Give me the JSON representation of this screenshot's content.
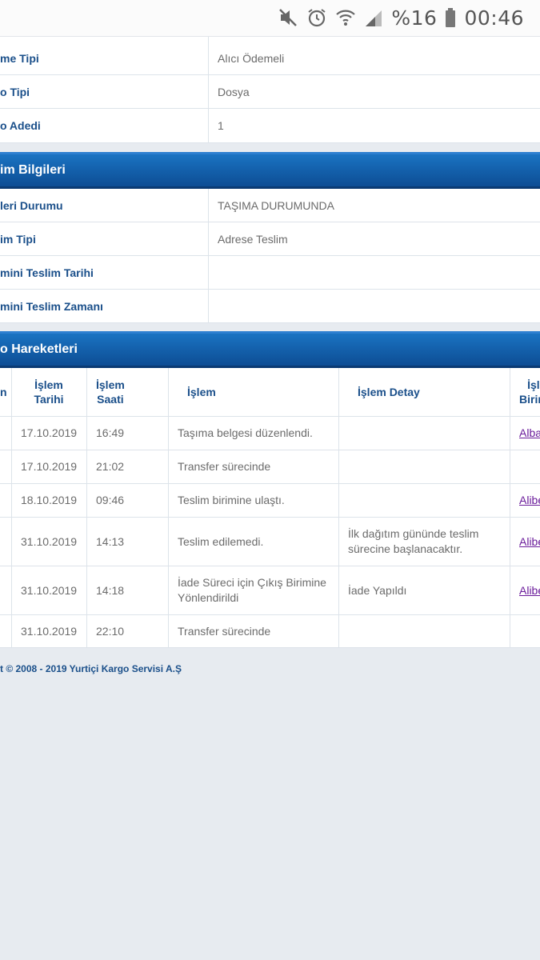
{
  "status_bar": {
    "battery_percent": "%16",
    "time": "00:46",
    "icons": [
      "mute-icon",
      "alarm-icon",
      "wifi-icon",
      "signal-icon",
      "battery-icon"
    ]
  },
  "shipment_info": {
    "rows": [
      {
        "label": "me Tipi",
        "value": "Alıcı Ödemeli"
      },
      {
        "label": "o Tipi",
        "value": "Dosya"
      },
      {
        "label": "o Adedi",
        "value": "1"
      }
    ]
  },
  "delivery_section": {
    "title": "im Bilgileri",
    "rows": [
      {
        "label": "leri Durumu",
        "value": "TAŞIMA DURUMUNDA"
      },
      {
        "label": "im Tipi",
        "value": "Adrese Teslim"
      },
      {
        "label": "mini Teslim Tarihi",
        "value": ""
      },
      {
        "label": "mini Teslim Zamanı",
        "value": ""
      }
    ]
  },
  "movements_section": {
    "title": "o Hareketleri",
    "headers": {
      "c0": "n",
      "date": "İşlem\nTarihi",
      "time": "İşlem\nSaati",
      "action": "İşlem",
      "detail": "İşlem Detay",
      "unit": "İşl\nBirim"
    },
    "rows": [
      {
        "date": "17.10.2019",
        "time": "16:49",
        "action": "Taşıma belgesi düzenlendi.",
        "detail": "",
        "unit": "Alba"
      },
      {
        "date": "17.10.2019",
        "time": "21:02",
        "action": "Transfer sürecinde",
        "detail": "",
        "unit": ""
      },
      {
        "date": "18.10.2019",
        "time": "09:46",
        "action": "Teslim birimine ulaştı.",
        "detail": "",
        "unit": "Alibe"
      },
      {
        "date": "31.10.2019",
        "time": "14:13",
        "action": "Teslim edilemedi.",
        "detail": "İlk dağıtım gününde teslim sürecine başlanacaktır.",
        "unit": "Alibe"
      },
      {
        "date": "31.10.2019",
        "time": "14:18",
        "action": "İade Süreci için Çıkış Birimine Yönlendirildi",
        "detail": "İade Yapıldı",
        "unit": "Alibe"
      },
      {
        "date": "31.10.2019",
        "time": "22:10",
        "action": "Transfer sürecinde",
        "detail": "",
        "unit": ""
      }
    ]
  },
  "footer": {
    "copyright": "t © 2008 - 2019 Yurtiçi Kargo Servisi A.Ş"
  }
}
